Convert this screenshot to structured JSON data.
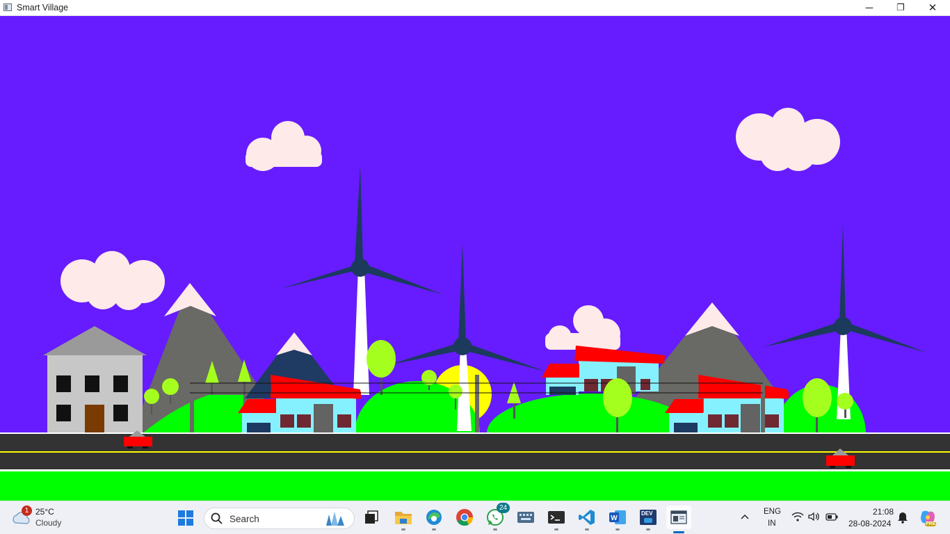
{
  "window": {
    "title": "Smart Village",
    "controls": {
      "minimize": "─",
      "maximize": "❐",
      "close": "✕"
    }
  },
  "scene": {
    "description_icons": [
      "cloud-icon",
      "mountain",
      "wind-turbine",
      "house",
      "tree",
      "car",
      "road",
      "power-line",
      "sun"
    ],
    "colors": {
      "sky": "#661cff",
      "grass": "#00ff00",
      "hill": "#00ff00",
      "mountain": "#696966",
      "mountain_dark": "#1f3a63",
      "snow": "#ffeaea",
      "cloud": "#ffeaea",
      "turbine_blade": "#1b3a5c",
      "turbine_tower": "#ffffff",
      "sun": "#ffff00",
      "road": "#333333",
      "road_lane": "#ffff00",
      "road_edge": "#ffffff",
      "roof_red": "#ff0000",
      "wall_cyan": "#86f1fe",
      "window_maroon": "#6f2933",
      "door_gray": "#636363",
      "garage_navy": "#1d3a63",
      "building_gray": "#c7c7c7",
      "roof_gray": "#9a9a9a",
      "window_black": "#111111",
      "door_brown": "#7a3b00",
      "tree_light": "#a5ff1e",
      "car_red": "#ff0000"
    }
  },
  "taskbar": {
    "weather": {
      "temp": "25°C",
      "condition": "Cloudy",
      "badge": "1",
      "icon": "weather-cloud-icon"
    },
    "search": {
      "label": "Search"
    },
    "apps": [
      {
        "name": "task-view",
        "icon": "task-view-icon"
      },
      {
        "name": "file-explorer",
        "icon": "folder-icon"
      },
      {
        "name": "edge",
        "icon": "edge-icon"
      },
      {
        "name": "chrome",
        "icon": "chrome-icon"
      },
      {
        "name": "whatsapp",
        "icon": "whatsapp-icon",
        "badge": "24"
      },
      {
        "name": "touch-keyboard",
        "icon": "keyboard-icon"
      },
      {
        "name": "terminal",
        "icon": "terminal-icon"
      },
      {
        "name": "vscode",
        "icon": "vscode-icon"
      },
      {
        "name": "word",
        "icon": "word-icon"
      },
      {
        "name": "devcpp",
        "icon": "devcpp-icon",
        "label": "DEV"
      },
      {
        "name": "smart-village-app",
        "icon": "window-app-icon"
      }
    ],
    "tray": {
      "chevron": "^",
      "lang_line1": "ENG",
      "lang_line2": "IN",
      "time": "21:08",
      "date": "28-08-2024",
      "copilot_tag": "PRE"
    }
  }
}
